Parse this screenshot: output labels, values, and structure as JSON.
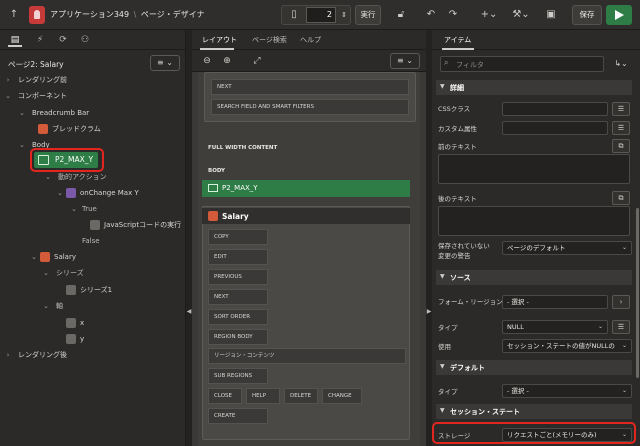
{
  "topbar": {
    "app_title": "アプリケーション349",
    "separator": "\\",
    "page_designer": "ページ・デザイナ",
    "page_number": "2",
    "run_label": "実行",
    "save_label": "保存"
  },
  "left": {
    "header": "ページ2: Salary",
    "tree": {
      "rendering_before": "レンダリング前",
      "components": "コンポーネント",
      "breadcrumb_bar": "Breadcrumb Bar",
      "breadcrumb": "ブレッドクラム",
      "body": "Body",
      "p2_max_y": "P2_MAX_Y",
      "dynamic_actions": "動的アクション",
      "onchange": "onChange Max Y",
      "true_label": "True",
      "js_exec": "JavaScriptコードの実行",
      "false_label": "False",
      "salary": "Salary",
      "series": "シリーズ",
      "series1": "シリーズ1",
      "axes": "軸",
      "axis_x": "x",
      "axis_y": "y",
      "rendering_after": "レンダリング後"
    }
  },
  "middle": {
    "tabs": [
      "レイアウト",
      "ページ検索",
      "ヘルプ"
    ],
    "slots_top": [
      "NEXT",
      "SEARCH FIELD AND SMART FILTERS"
    ],
    "full_width_content": "FULL WIDTH CONTENT",
    "body": "BODY",
    "item": "P2_MAX_Y",
    "salary": "Salary",
    "salary_slots": [
      "COPY",
      "EDIT",
      "PREVIOUS",
      "NEXT",
      "SORT ORDER",
      "REGION BODY",
      "リージョン・コンテンツ",
      "SUB REGIONS"
    ],
    "bottom_slots": [
      "CLOSE",
      "HELP",
      "DELETE",
      "CHANGE"
    ],
    "create": "CREATE"
  },
  "right": {
    "tab": "アイテム",
    "search_placeholder": "フィルタ",
    "groups": {
      "details": "詳細",
      "source": "ソース",
      "default": "デフォルト",
      "session_state": "セッション・ステート"
    },
    "props": {
      "css_classes": "CSSクラス",
      "custom_attributes": "カスタム属性",
      "pre_text": "前のテキスト",
      "post_text": "後のテキスト",
      "unsaved_warning_1": "保存されていない",
      "unsaved_warning_2": "変更の警告",
      "unsaved_warning_value": "ページのデフォルト",
      "form_region": "フォーム・リージョン",
      "form_region_value": "- 選択 -",
      "type": "タイプ",
      "type_value": "NULL",
      "used": "使用",
      "used_value": "セッション・ステートの値がNULLの",
      "default_type": "タイプ",
      "default_type_value": "- 選択 -",
      "storage": "ストレージ",
      "storage_value": "リクエストごと(メモリーのみ)"
    }
  },
  "colors": {
    "accent_green": "#2e7d46",
    "highlight_red": "#e0261f",
    "logo_red": "#c73a3a"
  }
}
